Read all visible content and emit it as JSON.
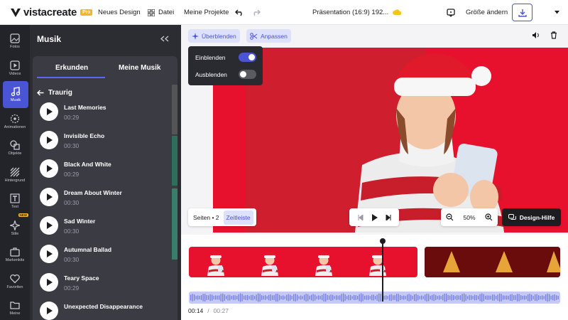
{
  "brand": {
    "name": "vistacreate",
    "badge": "Pro",
    "accent": "#4a55d6",
    "red": "#e8112d"
  },
  "menu": {
    "new_design": "Neues Design",
    "file": "Datei",
    "my_projects": "Meine Projekte"
  },
  "doc": {
    "title": "Präsentation (16:9) 192..."
  },
  "actions": {
    "resize": "Größe ändern"
  },
  "rail": [
    {
      "label": "Fotos",
      "icon": "image-icon"
    },
    {
      "label": "Videos",
      "icon": "video-icon"
    },
    {
      "label": "Musik",
      "icon": "music-note-icon",
      "active": true
    },
    {
      "label": "Animationen",
      "icon": "animation-icon"
    },
    {
      "label": "Objekte",
      "icon": "shapes-icon"
    },
    {
      "label": "Hintergrund",
      "icon": "background-icon"
    },
    {
      "label": "Text",
      "icon": "text-icon"
    },
    {
      "label": "Stile",
      "icon": "sparkle-icon",
      "badge": "NEW"
    },
    {
      "label": "Markenkits",
      "icon": "briefcase-icon"
    },
    {
      "label": "Favoriten",
      "icon": "heart-icon"
    },
    {
      "label": "Meine",
      "icon": "folder-icon"
    }
  ],
  "music": {
    "title": "Musik",
    "tabs": [
      "Erkunden",
      "Meine Musik"
    ],
    "category": "Traurig",
    "tracks": [
      {
        "name": "Last Memories",
        "duration": "00:29"
      },
      {
        "name": "Invisible Echo",
        "duration": "00:30"
      },
      {
        "name": "Black And White",
        "duration": "00:29"
      },
      {
        "name": "Dream About Winter",
        "duration": "00:30"
      },
      {
        "name": "Sad Winter",
        "duration": "00:30"
      },
      {
        "name": "Autumnal Ballad",
        "duration": "00:30"
      },
      {
        "name": "Teary Space",
        "duration": "00:29"
      },
      {
        "name": "Unexpected Disappearance",
        "duration": ""
      }
    ]
  },
  "toolbar": {
    "fade": "Überblenden",
    "adjust": "Anpassen"
  },
  "fade_popup": {
    "fade_in": "Einblenden",
    "fade_in_on": true,
    "fade_out": "Ausblenden",
    "fade_out_on": false
  },
  "page_controls": {
    "pages": "Seiten • 2",
    "timeline": "Zeitleiste"
  },
  "zoom": {
    "value": "50%"
  },
  "help": {
    "label": "Design-Hilfe"
  },
  "playback": {
    "current": "00:14",
    "separator": "/",
    "total": "00:27",
    "progress": 0.52
  }
}
